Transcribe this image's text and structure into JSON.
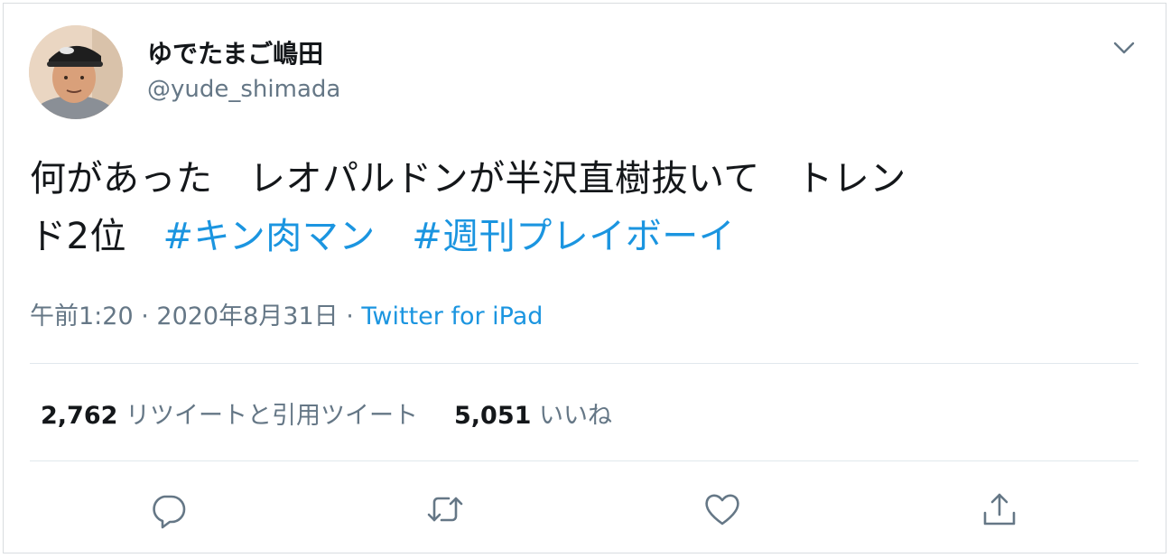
{
  "author": {
    "display_name": "ゆでたまご嶋田",
    "handle": "@yude_shimada",
    "avatar_icon": "avatar-photo"
  },
  "tweet": {
    "text_line1": "何があった　レオパルドンが半沢直樹抜いて　トレン",
    "text_line2_plain": "ド2位　",
    "hashtag1": "#キン肉マン",
    "gap": "　",
    "hashtag2": "#週刊プレイボーイ"
  },
  "meta": {
    "time": "午前1:20",
    "separator": " · ",
    "date": "2020年8月31日",
    "separator2": " · ",
    "source": "Twitter for iPad"
  },
  "stats": {
    "retweets_count": "2,762",
    "retweets_label": "リツイートと引用ツイート",
    "likes_count": "5,051",
    "likes_label": "いいね"
  },
  "actions": {
    "reply_icon": "reply-icon",
    "retweet_icon": "retweet-icon",
    "like_icon": "heart-icon",
    "share_icon": "share-icon"
  },
  "colors": {
    "link": "#1b95e0",
    "secondary": "#657786",
    "primary_text": "#14171a",
    "divider": "#e1e8ed"
  }
}
